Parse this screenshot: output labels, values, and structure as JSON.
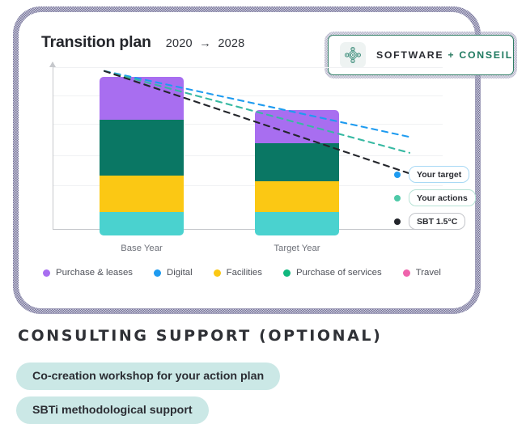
{
  "card": {
    "title": "Transition plan",
    "year_range": "2020  →  2028"
  },
  "brand": {
    "icon": "network-nodes-icon",
    "word_1": "SOFTWARE",
    "plus": "+",
    "word_2": "CONSEIL",
    "border_color": "#2e7d64",
    "accent_color": "#1f7a60"
  },
  "chart_data": {
    "type": "bar",
    "stacked": true,
    "title": "Transition plan",
    "subtitle": "2020 → 2028",
    "xlabel": "",
    "ylabel": "",
    "grid": true,
    "gridlines": 5,
    "axis_ticks_visible": false,
    "categories": [
      "Base Year",
      "Target Year"
    ],
    "series": [
      {
        "name": "Purchase & leases",
        "color": "#a86ef0",
        "values": [
          27.0,
          21.0
        ]
      },
      {
        "name": "Purchase of services",
        "color": "#0a7764",
        "values": [
          35.5,
          24.0
        ]
      },
      {
        "name": "Facilities",
        "color": "#fbc814",
        "values": [
          22.5,
          19.0
        ]
      },
      {
        "name": "Digital",
        "color": "#4ad2cf",
        "values": [
          15.0,
          15.0
        ]
      },
      {
        "name": "Travel",
        "color": "#ef63ac",
        "values": [
          0.0,
          0.0
        ]
      }
    ],
    "totals": [
      100.0,
      79.0
    ],
    "trajectories": [
      {
        "name": "Your target",
        "color": "#1e9bf0",
        "start": 100.0,
        "end": 58.0
      },
      {
        "name": "Your actions",
        "color": "#37b9a2",
        "start": 100.0,
        "end": 48.0
      },
      {
        "name": "SBT 1.5°C",
        "color": "#23252b",
        "start": 100.0,
        "end": 35.0
      }
    ]
  },
  "legend": {
    "items": [
      {
        "label": "Purchase & leases",
        "color": "#a86ef0"
      },
      {
        "label": "Digital",
        "color": "#1e9bf0"
      },
      {
        "label": "Facilities",
        "color": "#fbc814"
      },
      {
        "label": "Purchase of services",
        "color": "#11b87e"
      },
      {
        "label": "Travel",
        "color": "#ef63ac"
      }
    ]
  },
  "trajectory_labels": [
    {
      "label": "Your target",
      "dot_color": "#1e9bf0",
      "border_color": "#a9d9f5"
    },
    {
      "label": "Your actions",
      "dot_color": "#4ec9a8",
      "border_color": "#b7e3d6"
    },
    {
      "label": "SBT 1.5°C",
      "dot_color": "#23252b",
      "border_color": "#c3c5ca"
    }
  ],
  "consulting": {
    "heading": "Consulting support (optional)",
    "options": [
      "Co-creation workshop for your action plan",
      "SBTi methodological support"
    ]
  }
}
